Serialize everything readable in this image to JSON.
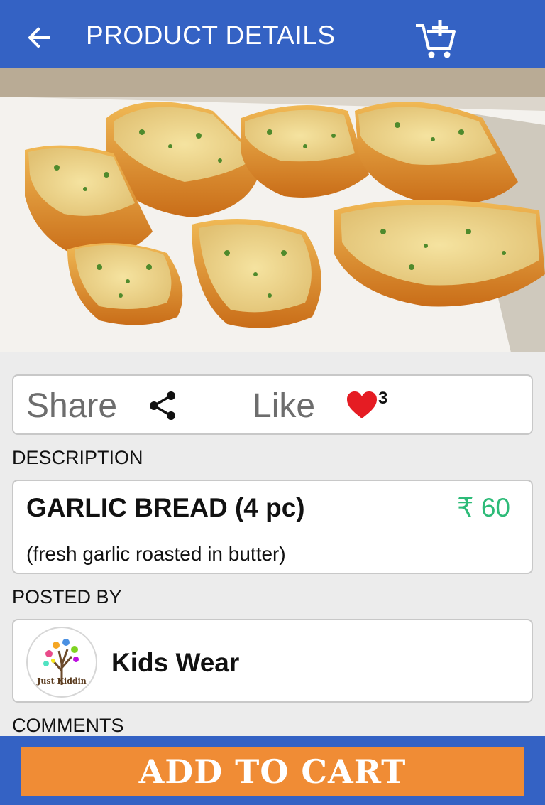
{
  "header": {
    "title": "PRODUCT DETAILS",
    "back_icon": "arrow-left-icon",
    "cart_icon": "add-to-cart-icon"
  },
  "hero": {
    "icon": "product-photo"
  },
  "social": {
    "share_label": "Share",
    "share_icon": "share-icon",
    "like_label": "Like",
    "like_icon": "heart-icon",
    "like_count": "3",
    "like_color": "#e51c23"
  },
  "description": {
    "section_label": "DESCRIPTION",
    "product_name": "GARLIC BREAD (4 pc)",
    "price": "₹ 60",
    "subtitle": "(fresh garlic roasted in butter)",
    "price_color": "#2dbb78"
  },
  "posted_by": {
    "section_label": "POSTED BY",
    "seller_name": "Kids Wear",
    "avatar_text": "Just Kiddin"
  },
  "comments": {
    "section_label": "COMMENTS"
  },
  "footer": {
    "add_to_cart_label": "ADD TO CART",
    "button_color": "#f08c35",
    "bar_color": "#3462c4"
  }
}
